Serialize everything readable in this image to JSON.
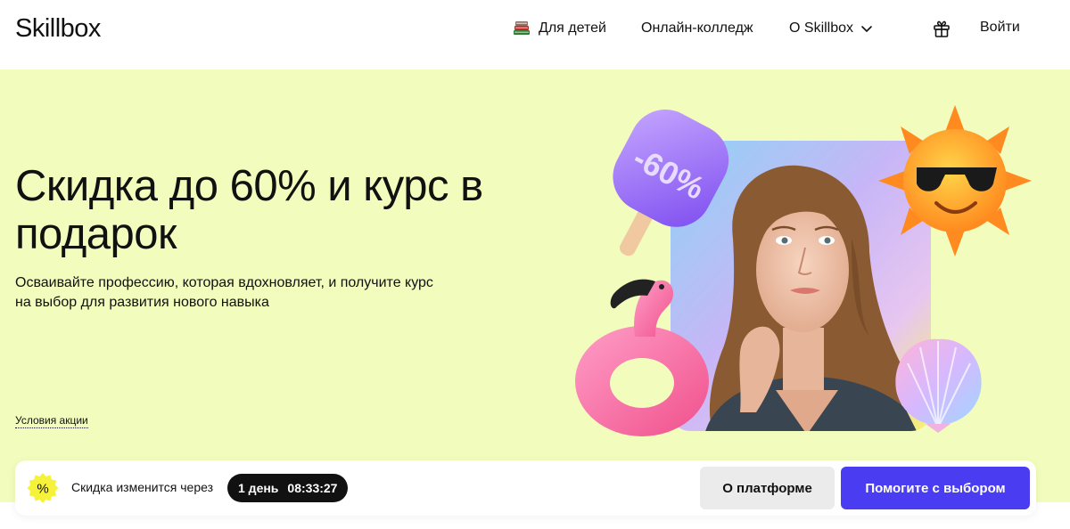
{
  "header": {
    "logo": "Skillbox",
    "nav": {
      "kids": "Для детей",
      "college": "Онлайн-колледж",
      "about": "О Skillbox"
    },
    "login": "Войти",
    "icons": [
      "books-icon",
      "chevron-down-icon",
      "gift-icon"
    ]
  },
  "hero": {
    "title": "Скидка до 60% и курс в подарок",
    "subtitle": "Осваивайте профессию, которая вдохновляет, и получите курс на выбор для развития нового навыка",
    "terms_link": "Условия акции",
    "popsicle_text": "-60%",
    "background_color": "#f2fcbc"
  },
  "promo_bar": {
    "badge_symbol": "%",
    "discount_text": "Скидка изменится через",
    "timer_days": "1 день",
    "timer_time": "08:33:27",
    "platform_button": "О платформе",
    "help_button": "Помогите с выбором",
    "accent_color": "#4a3cf0"
  }
}
